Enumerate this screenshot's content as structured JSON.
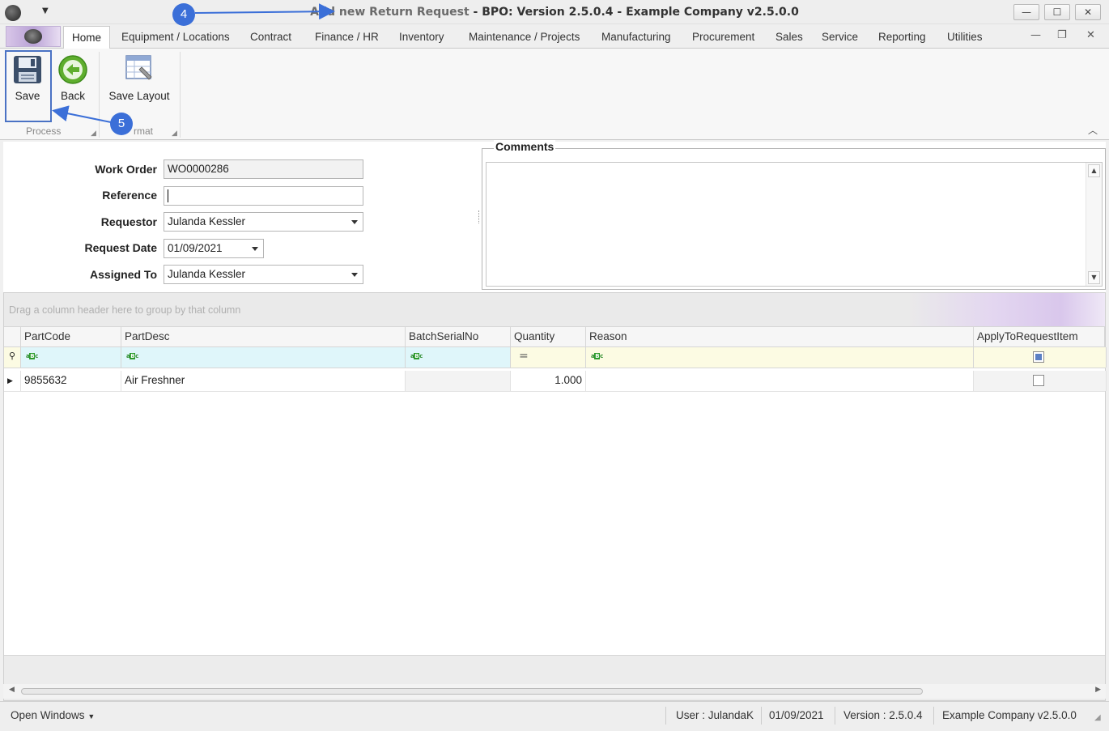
{
  "window": {
    "title_prefix": "Add new Return Request",
    "title_main": "BPO: Version 2.5.0.4 - Example Company v2.5.0.0",
    "title_sep": " - ",
    "minimize": "—",
    "maximize": "☐",
    "close": "✕"
  },
  "menu_tabs": [
    "Home",
    "Equipment / Locations",
    "Contract",
    "Finance / HR",
    "Inventory",
    "Maintenance / Projects",
    "Manufacturing",
    "Procurement",
    "Sales",
    "Service",
    "Reporting",
    "Utilities"
  ],
  "ribbon": {
    "save": "Save",
    "back": "Back",
    "save_layout": "Save Layout",
    "group_process": "Process",
    "group_format": "rmat"
  },
  "form": {
    "work_order_label": "Work Order",
    "work_order": "WO0000286",
    "reference_label": "Reference",
    "reference": "",
    "requestor_label": "Requestor",
    "requestor": "Julanda Kessler",
    "request_date_label": "Request Date",
    "request_date": "01/09/2021",
    "assigned_to_label": "Assigned To",
    "assigned_to": "Julanda Kessler",
    "comments_label": "Comments"
  },
  "grid": {
    "group_hint": "Drag a column header here to group by that column",
    "columns": [
      "PartCode",
      "PartDesc",
      "BatchSerialNo",
      "Quantity",
      "Reason",
      "ApplyToRequestItem"
    ],
    "rows": [
      {
        "PartCode": "9855632",
        "PartDesc": "Air Freshner",
        "BatchSerialNo": "",
        "Quantity": "1.000",
        "Reason": "",
        "ApplyToRequestItem": false
      }
    ]
  },
  "status": {
    "open_windows": "Open Windows",
    "user": "User : JulandaK",
    "date": "01/09/2021",
    "version": "Version : 2.5.0.4",
    "company": "Example Company v2.5.0.0"
  },
  "annotations": {
    "step4": "4",
    "step5": "5"
  },
  "colors": {
    "accent": "#3b6fd8",
    "filter_cyan": "#dff6fa",
    "filter_yellow": "#fcfbe3"
  }
}
